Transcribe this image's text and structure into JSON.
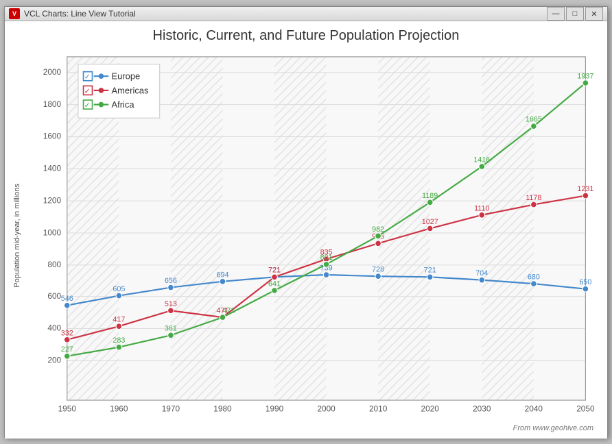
{
  "window": {
    "title": "VCL Charts: Line View Tutorial",
    "icon_label": "V"
  },
  "titlebar_buttons": {
    "minimize": "—",
    "maximize": "□",
    "close": "✕"
  },
  "chart": {
    "title": "Historic, Current, and Future Population Projection",
    "y_axis_label": "Population mid-year, in millions",
    "source": "From www.geohive.com",
    "x_labels": [
      "1950",
      "1960",
      "1970",
      "1980",
      "1990",
      "2000",
      "2010",
      "2020",
      "2030",
      "2040",
      "2050"
    ],
    "y_labels": [
      "200",
      "400",
      "600",
      "800",
      "1000",
      "1200",
      "1400",
      "1600",
      "1800",
      "2000"
    ],
    "series": [
      {
        "name": "Europe",
        "color": "#4488cc",
        "data": [
          {
            "year": 1950,
            "value": 546
          },
          {
            "year": 1960,
            "value": 605
          },
          {
            "year": 1970,
            "value": 656
          },
          {
            "year": 1980,
            "value": 694
          },
          {
            "year": 1990,
            "value": 721
          },
          {
            "year": 2000,
            "value": 739
          },
          {
            "year": 2010,
            "value": 728
          },
          {
            "year": 2020,
            "value": 721
          },
          {
            "year": 2030,
            "value": 704
          },
          {
            "year": 2040,
            "value": 680
          },
          {
            "year": 2050,
            "value": 650
          }
        ]
      },
      {
        "name": "Americas",
        "color": "#cc3344",
        "data": [
          {
            "year": 1950,
            "value": 332
          },
          {
            "year": 1960,
            "value": 417
          },
          {
            "year": 1970,
            "value": 513
          },
          {
            "year": 1980,
            "value": 471
          },
          {
            "year": 1990,
            "value": 721
          },
          {
            "year": 2000,
            "value": 835
          },
          {
            "year": 2010,
            "value": 935
          },
          {
            "year": 2020,
            "value": 1027
          },
          {
            "year": 2030,
            "value": 1110
          },
          {
            "year": 2040,
            "value": 1178
          },
          {
            "year": 2050,
            "value": 1231
          }
        ]
      },
      {
        "name": "Africa",
        "color": "#44aa44",
        "data": [
          {
            "year": 1950,
            "value": 227
          },
          {
            "year": 1960,
            "value": 283
          },
          {
            "year": 1970,
            "value": 361
          },
          {
            "year": 1980,
            "value": 471
          },
          {
            "year": 1990,
            "value": 641
          },
          {
            "year": 2000,
            "value": 801
          },
          {
            "year": 2010,
            "value": 982
          },
          {
            "year": 2020,
            "value": 1189
          },
          {
            "year": 2030,
            "value": 1416
          },
          {
            "year": 2040,
            "value": 1665
          },
          {
            "year": 2050,
            "value": 1937
          }
        ]
      }
    ]
  },
  "legend": {
    "europe_label": "Europe",
    "americas_label": "Americas",
    "africa_label": "Africa"
  }
}
